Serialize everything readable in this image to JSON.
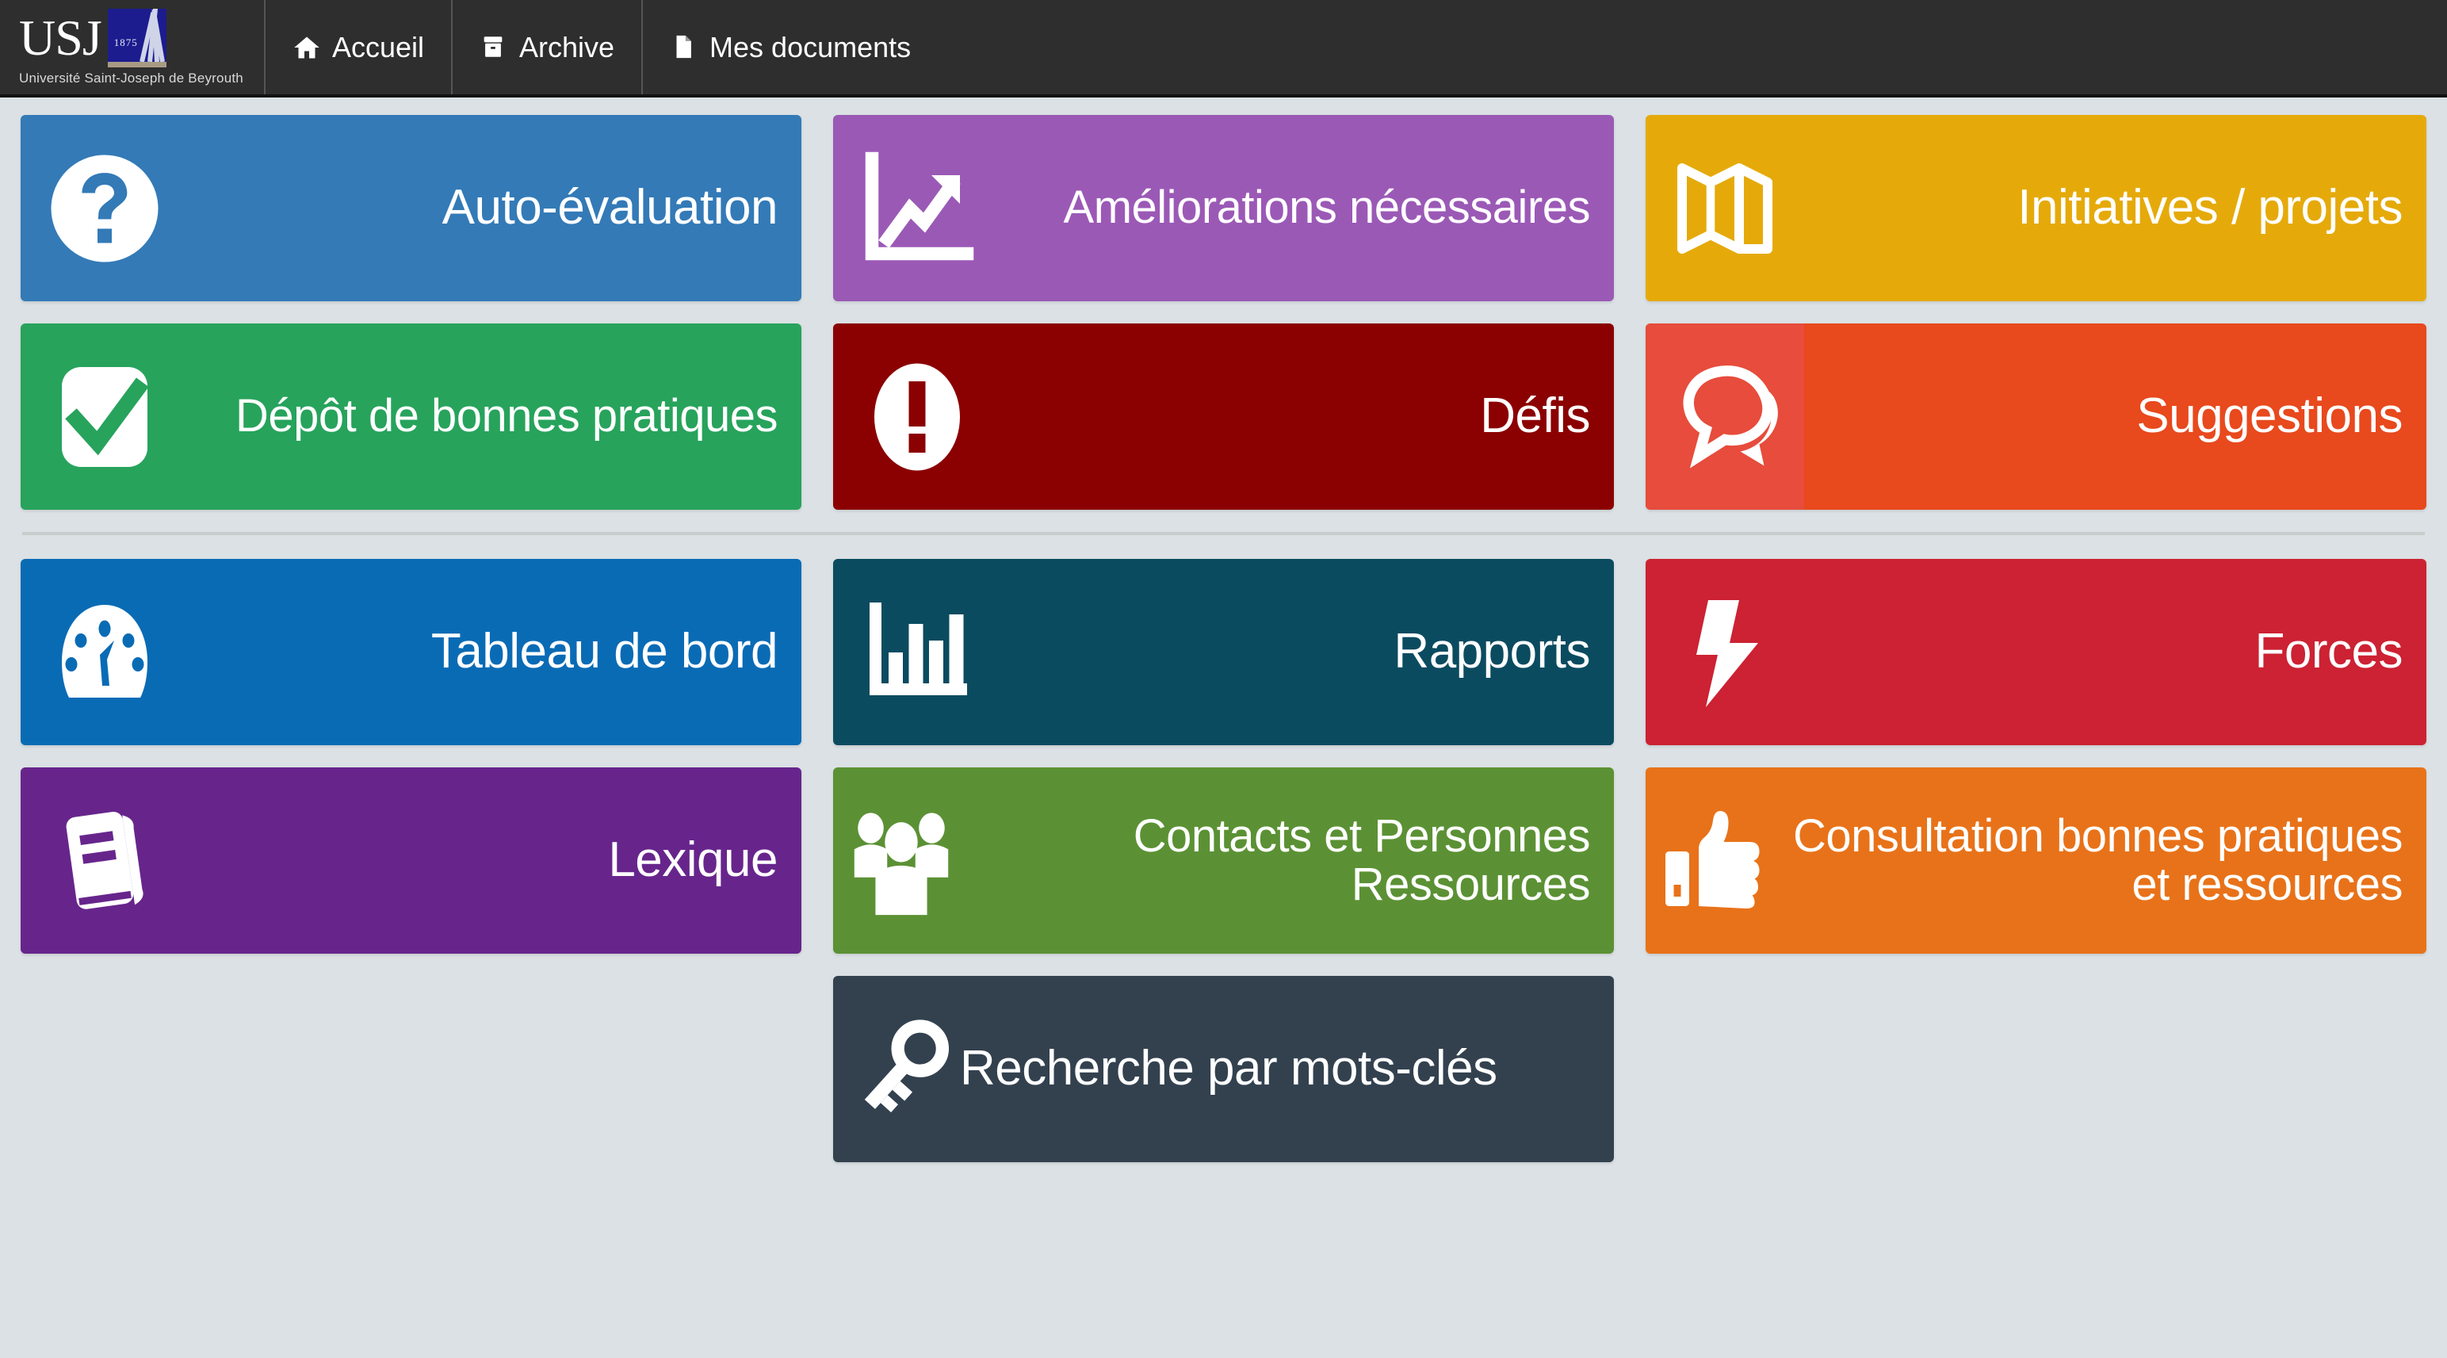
{
  "brand": {
    "acronym": "USJ",
    "subtitle": "Université Saint-Joseph de Beyrouth",
    "emblem_year": "1875"
  },
  "nav": {
    "items": [
      {
        "label": "Accueil",
        "icon": "home-icon"
      },
      {
        "label": "Archive",
        "icon": "archive-icon"
      },
      {
        "label": "Mes documents",
        "icon": "document-icon"
      }
    ]
  },
  "colors": {
    "page_background": "#dbe1e4",
    "navbar_background": "#2e2e2e",
    "divider": "#c9cccd",
    "tile_text": "#ffffff"
  },
  "tiles": {
    "row1": [
      {
        "label": "Auto-évaluation",
        "icon": "question-circle-icon",
        "color": "#337ab7"
      },
      {
        "label": "Améliorations nécessaires",
        "icon": "line-chart-up-icon",
        "color": "#9b59b6"
      },
      {
        "label": "Initiatives / projets",
        "icon": "folded-map-icon",
        "color": "#e5aa0a"
      }
    ],
    "row2": [
      {
        "label": "Dépôt de bonnes pratiques",
        "icon": "check-square-icon",
        "color": "#27a35c"
      },
      {
        "label": "Défis",
        "icon": "exclamation-circle-icon",
        "color": "#8b0000"
      },
      {
        "label": "Suggestions",
        "icon": "speech-bubbles-icon",
        "color": "#e8491d",
        "icon_panel_color": "#e74c3c"
      }
    ],
    "row3": [
      {
        "label": "Tableau de bord",
        "icon": "dashboard-gauge-icon",
        "color": "#0a6bb5"
      },
      {
        "label": "Rapports",
        "icon": "bar-chart-icon",
        "color": "#0b4b60"
      },
      {
        "label": "Forces",
        "icon": "lightning-bolt-icon",
        "color": "#cc2233"
      }
    ],
    "row4": [
      {
        "label": "Lexique",
        "icon": "book-icon",
        "color": "#67258c"
      },
      {
        "label": "Contacts et Personnes Ressources",
        "icon": "people-group-icon",
        "color": "#5b9134"
      },
      {
        "label": "Consultation bonnes pratiques et ressources",
        "icon": "thumbs-up-icon",
        "color": "#e87219"
      }
    ],
    "row5": [
      {
        "label": "Recherche par mots-clés",
        "icon": "key-icon",
        "color": "#33414f"
      }
    ]
  }
}
